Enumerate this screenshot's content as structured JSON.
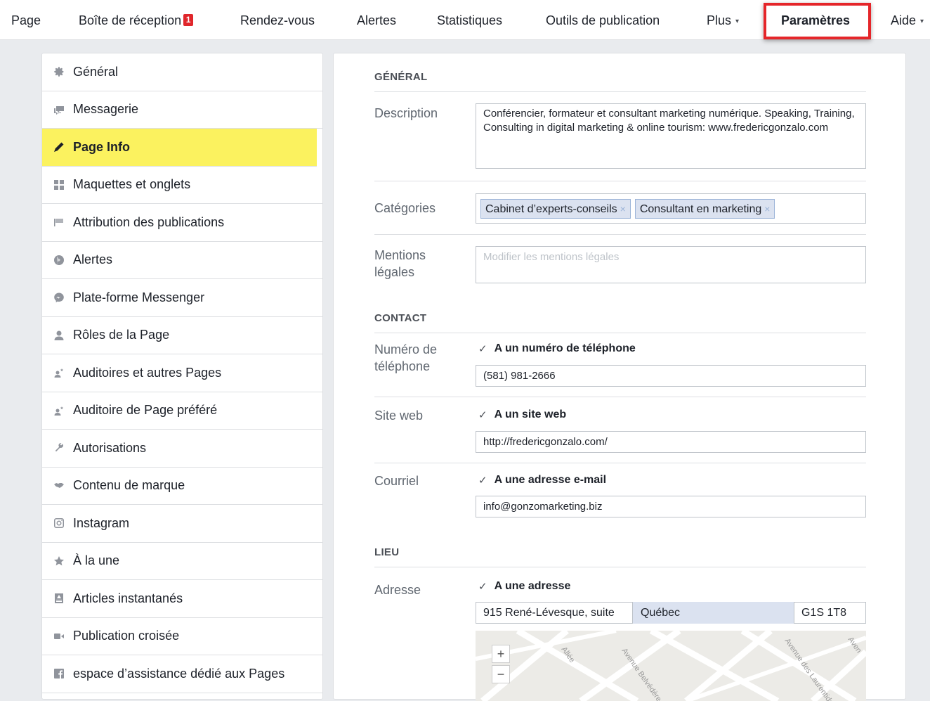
{
  "nav": {
    "items": [
      {
        "label": "Page"
      },
      {
        "label": "Boîte de réception",
        "badge": "1"
      },
      {
        "label": "Rendez-vous"
      },
      {
        "label": "Alertes"
      },
      {
        "label": "Statistiques"
      },
      {
        "label": "Outils de publication"
      },
      {
        "label": "Plus",
        "caret": "▾"
      },
      {
        "label": "Paramètres",
        "active": true
      },
      {
        "label": "Aide",
        "caret": "▾"
      }
    ]
  },
  "sidebar": {
    "items": [
      {
        "label": "Général",
        "icon": "gear-icon"
      },
      {
        "label": "Messagerie",
        "icon": "messaging-icon"
      },
      {
        "label": "Page Info",
        "icon": "pencil-icon",
        "active": true
      },
      {
        "label": "Maquettes et onglets",
        "icon": "grid-icon"
      },
      {
        "label": "Attribution des publications",
        "icon": "flag-icon"
      },
      {
        "label": "Alertes",
        "icon": "globe-icon"
      },
      {
        "label": "Plate-forme Messenger",
        "icon": "messenger-icon"
      },
      {
        "label": "Rôles de la Page",
        "icon": "person-icon"
      },
      {
        "label": "Auditoires et autres Pages",
        "icon": "audience-icon"
      },
      {
        "label": "Auditoire de Page préféré",
        "icon": "audience-icon"
      },
      {
        "label": "Autorisations",
        "icon": "wrench-icon"
      },
      {
        "label": "Contenu de marque",
        "icon": "handshake-icon"
      },
      {
        "label": "Instagram",
        "icon": "instagram-icon"
      },
      {
        "label": "À la une",
        "icon": "star-icon"
      },
      {
        "label": "Articles instantanés",
        "icon": "article-icon"
      },
      {
        "label": "Publication croisée",
        "icon": "video-icon"
      },
      {
        "label": "espace d’assistance dédié aux Pages",
        "icon": "facebook-icon"
      }
    ]
  },
  "main": {
    "general": {
      "heading": "GÉNÉRAL",
      "description_label": "Description",
      "description_value": "Conférencier, formateur et consultant marketing numérique. Speaking, Training, Consulting in digital marketing & online tourism: www.fredericgonzalo.com",
      "categories_label": "Catégories",
      "categories": [
        "Cabinet d’experts-conseils",
        "Consultant en marketing"
      ],
      "tag_remove": "×",
      "legal_label_1": "Mentions",
      "legal_label_2": "légales",
      "legal_placeholder": "Modifier les mentions légales"
    },
    "contact": {
      "heading": "CONTACT",
      "phone_label_1": "Numéro de",
      "phone_label_2": "téléphone",
      "phone_check": "A un numéro de téléphone",
      "phone_value": "(581) 981-2666",
      "website_label": "Site web",
      "website_check": "A un site web",
      "website_value": "http://fredericgonzalo.com/",
      "email_label": "Courriel",
      "email_check": "A une adresse e-mail",
      "email_value": "info@gonzomarketing.biz"
    },
    "location": {
      "heading": "LIEU",
      "address_label": "Adresse",
      "address_check": "A une adresse",
      "street": "915 René-Lévesque, suite",
      "city": "Québec",
      "postal": "G1S 1T8",
      "zoom_in": "+",
      "zoom_out": "−",
      "map_streets": [
        "Allée",
        "Avenue Belvédère",
        "Avenue des Laurentides",
        "Aven"
      ]
    }
  },
  "colors": {
    "highlight": "#fbf25f",
    "annotation_box": "#e5262a",
    "tag_bg": "#dbe2f0"
  }
}
